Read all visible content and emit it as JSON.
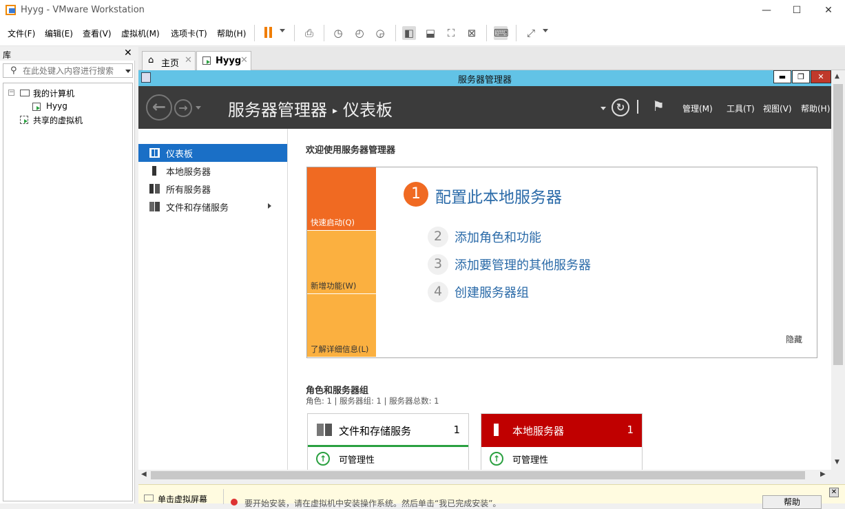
{
  "window": {
    "title": "Hyyg - VMware Workstation",
    "minimize": "—",
    "maximize": "☐",
    "close": "✕"
  },
  "menu": [
    "文件(F)",
    "编辑(E)",
    "查看(V)",
    "虚拟机(M)",
    "选项卡(T)",
    "帮助(H)"
  ],
  "library": {
    "title": "库",
    "close": "✕",
    "search_placeholder": "在此处键入内容进行搜索",
    "tree": {
      "my_computer": "我的计算机",
      "vm": "Hyyg",
      "shared": "共享的虚拟机",
      "expander": "−"
    }
  },
  "tabs": [
    {
      "label": "主页",
      "close": "✕"
    },
    {
      "label": "Hyyg",
      "close": "✕"
    }
  ],
  "guest": {
    "title": "服务器管理器",
    "btn_min": "▬",
    "btn_restore": "❐",
    "btn_close": "✕",
    "breadcrumb_app": "服务器管理器",
    "breadcrumb_sep": "▸",
    "breadcrumb_page": "仪表板",
    "header_menu": [
      "管理(M)",
      "工具(T)",
      "视图(V)",
      "帮助(H)"
    ],
    "nav": [
      "仪表板",
      "本地服务器",
      "所有服务器",
      "文件和存储服务"
    ],
    "welcome_title": "欢迎使用服务器管理器",
    "quick_tiles": [
      "快速启动(Q)",
      "新增功能(W)",
      "了解详细信息(L)"
    ],
    "step1_num": "1",
    "step1_label": "配置此本地服务器",
    "steps": [
      {
        "num": "2",
        "label": "添加角色和功能"
      },
      {
        "num": "3",
        "label": "添加要管理的其他服务器"
      },
      {
        "num": "4",
        "label": "创建服务器组"
      }
    ],
    "hide": "隐藏",
    "roles_title": "角色和服务器组",
    "roles_counts": "角色: 1 | 服务器组: 1 | 服务器总数: 1",
    "role_cards": [
      {
        "name": "文件和存储服务",
        "count": "1",
        "status": "可管理性"
      },
      {
        "name": "本地服务器",
        "count": "1",
        "status": "可管理性"
      }
    ]
  },
  "status_strip": {
    "label": "单击虚拟屏幕",
    "message": "要开始安装，请在虚拟机中安装操作系统。然后单击“我已完成安装”。",
    "button": "帮助",
    "close": "✕"
  },
  "colors": {
    "accent_orange": "#f07d00",
    "guest_titlebar": "#62c3e6",
    "sm_header": "#3b3b3b",
    "nav_active": "#1a6fc6",
    "tile_orange": "#f06a22",
    "tile_light": "#fbb040",
    "local_server_red": "#c00000",
    "link_blue": "#2a6aa8"
  }
}
